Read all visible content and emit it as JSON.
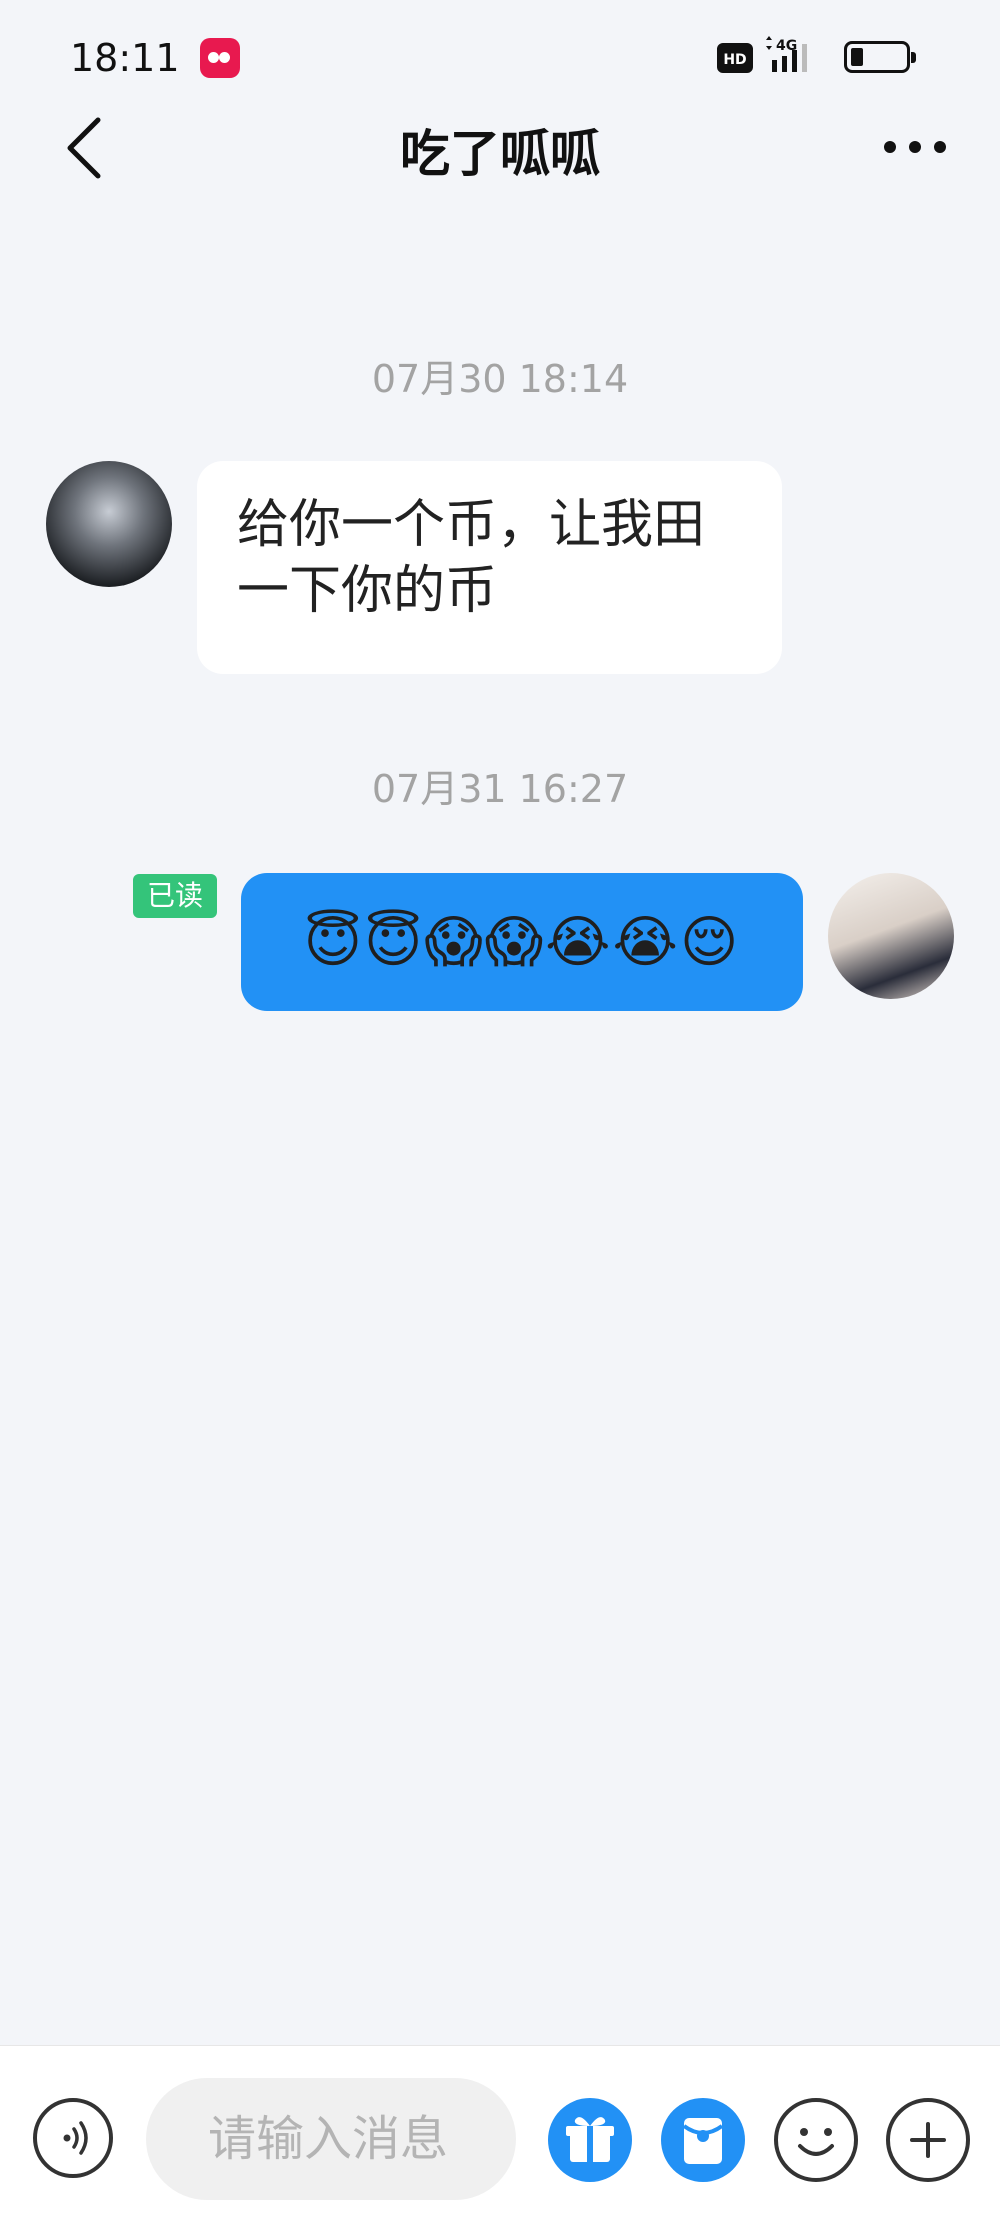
{
  "status_bar": {
    "time": "18:11",
    "network": "4G",
    "hd": "HD"
  },
  "header": {
    "title": "吃了呱呱"
  },
  "messages": [
    {
      "timestamp": "07月30 18:14",
      "direction": "incoming",
      "text": "给你一个币，让我田一下你的币"
    },
    {
      "timestamp": "07月31 16:27",
      "direction": "outgoing",
      "text": "😇😇😱😱😭😭😌",
      "read_label": "已读"
    }
  ],
  "composer": {
    "placeholder": "请输入消息"
  },
  "colors": {
    "background": "#f3f5f9",
    "outgoing_bubble": "#2291f5",
    "incoming_bubble": "#ffffff",
    "read_badge": "#34c47a",
    "timestamp": "#a3a3a3"
  },
  "icons": {
    "back": "chevron-left-icon",
    "more": "ellipsis-icon",
    "voice": "voice-icon",
    "gift": "gift-icon",
    "red_packet": "red-packet-icon",
    "emoji": "emoji-icon",
    "plus": "plus-icon"
  }
}
